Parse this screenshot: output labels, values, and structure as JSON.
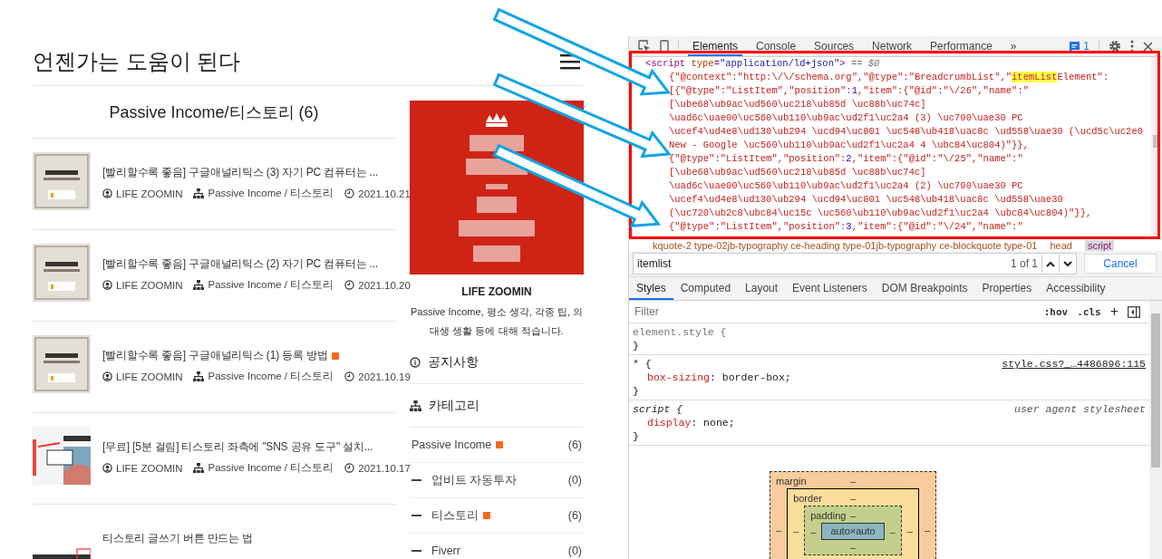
{
  "blog": {
    "title": "언젠가는 도움이 된다",
    "category_heading": "Passive Income/티스토리 (6)",
    "posts": [
      {
        "title": "[빨리할수록 좋음] 구글애널리틱스 (3) 자기 PC 컴퓨터는 ...",
        "new": false,
        "author": "LIFE ZOOMIN",
        "category": "Passive Income / 티스토리",
        "date": "2021.10.21"
      },
      {
        "title": "[빨리할수록 좋음] 구글애널리틱스 (2) 자기 PC 컴퓨터는 ...",
        "new": false,
        "author": "LIFE ZOOMIN",
        "category": "Passive Income / 티스토리",
        "date": "2021.10.20"
      },
      {
        "title": "[빨리할수록 좋음] 구글애널리틱스 (1) 등록 방법",
        "new": true,
        "author": "LIFE ZOOMIN",
        "category": "Passive Income / 티스토리",
        "date": "2021.10.19"
      },
      {
        "title": "[무료] [5분 걸림] 티스토리 좌측에 \"SNS 공유 도구\" 설치...",
        "new": false,
        "author": "LIFE ZOOMIN",
        "category": "Passive Income / 티스토리",
        "date": "2021.10.17"
      },
      {
        "title": "티스토리 글쓰기 버튼 만드는 법",
        "new": false
      }
    ],
    "profile": {
      "name": "LIFE ZOOMIN",
      "description": "Passive Income, 평소 생각, 각종 팁, 의대생 생활 등에 대해 적습니다."
    },
    "notice_heading": "공지사항",
    "category_section": {
      "heading": "카테고리",
      "items": [
        {
          "name": "Passive Income",
          "new": true,
          "count": "(6)",
          "children": [
            {
              "name": "업비트 자동투자",
              "new": false,
              "count": "(0)"
            },
            {
              "name": "티스토리",
              "new": true,
              "count": "(6)"
            },
            {
              "name": "Fiverr",
              "new": false,
              "count": "(0)"
            }
          ]
        }
      ]
    }
  },
  "devtools": {
    "tabs": [
      {
        "label": "Elements",
        "selected": true
      },
      {
        "label": "Console",
        "selected": false
      },
      {
        "label": "Sources",
        "selected": false
      },
      {
        "label": "Network",
        "selected": false
      },
      {
        "label": "Performance",
        "selected": false
      }
    ],
    "more": "»",
    "message_count": "1",
    "code_lines": [
      [
        {
          "kind": "tag",
          "text": "<script"
        },
        {
          "kind": "attr",
          "text": " type"
        },
        {
          "kind": "tag",
          "text": "="
        },
        {
          "kind": "value",
          "text": "\"application/ld+json\""
        },
        {
          "kind": "tag",
          "text": ">"
        },
        {
          "kind": "note",
          "text": " == $0"
        }
      ],
      [
        {
          "kind": "text",
          "text": "{\"@context\":\"http:\\/\\/schema.org\",\"@type\":\"BreadcrumbList\",\""
        },
        {
          "kind": "highlight",
          "text": "itemList"
        },
        {
          "kind": "text",
          "text": "Element\":"
        }
      ],
      [
        {
          "kind": "text",
          "text": "[{\"@type\":\"ListItem\",\"position\":"
        },
        {
          "kind": "number",
          "text": "1"
        },
        {
          "kind": "text",
          "text": ",\"item\":{\"@id\":\"\\/26\",\"name\":\""
        }
      ],
      [
        {
          "kind": "text",
          "text": "[\\ube68\\ub9ac\\ud560\\uc218\\ub85d \\uc88b\\uc74c]"
        }
      ],
      [
        {
          "kind": "text",
          "text": "\\uad6c\\uae00\\uc560\\ub110\\ub9ac\\ud2f1\\uc2a4 (3) \\uc790\\uae30 PC"
        }
      ],
      [
        {
          "kind": "text",
          "text": "\\ucef4\\ud4e8\\ud130\\ub294 \\ucd94\\uc801 \\uc548\\ub418\\uac8c \\ud558\\uae30 (\\ucd5c\\uc2e0"
        }
      ],
      [
        {
          "kind": "text",
          "text": "New - Google \\uc560\\ub110\\ub9ac\\ud2f1\\uc2a4 4 \\ubc84\\uc804)\"}},"
        }
      ],
      [
        {
          "kind": "text",
          "text": "{\"@type\":\"ListItem\",\"position\":"
        },
        {
          "kind": "number",
          "text": "2"
        },
        {
          "kind": "text",
          "text": ",\"item\":{\"@id\":\"\\/25\",\"name\":\""
        }
      ],
      [
        {
          "kind": "text",
          "text": "[\\ube68\\ub9ac\\ud560\\uc218\\ub85d \\uc88b\\uc74c]"
        }
      ],
      [
        {
          "kind": "text",
          "text": "\\uad6c\\uae00\\uc560\\ub110\\ub9ac\\ud2f1\\uc2a4 (2) \\uc790\\uae30 PC"
        }
      ],
      [
        {
          "kind": "text",
          "text": "\\ucef4\\ud4e8\\ud130\\ub294 \\ucd94\\uc801 \\uc548\\ub418\\uac8c \\ud558\\uae30"
        }
      ],
      [
        {
          "kind": "text",
          "text": "(\\uc720\\ub2c8\\ubc84\\uc15c \\uc560\\ub110\\ub9ac\\ud2f1\\uc2a4 \\ubc84\\uc804)\"}},"
        }
      ],
      [
        {
          "kind": "text",
          "text": "{\"@type\":\"ListItem\",\"position\":"
        },
        {
          "kind": "number",
          "text": "3"
        },
        {
          "kind": "text",
          "text": ",\"item\":{\"@id\":\"\\/24\",\"name\":\""
        }
      ]
    ],
    "breadcrumb": [
      {
        "label": "kquote-2 type-02jb-typography ce-heading type-01jb-typography ce-blockquote type-01",
        "selected": false
      },
      {
        "label": "head",
        "selected": false
      },
      {
        "label": "script",
        "selected": true
      }
    ],
    "search": {
      "value": "itemlist",
      "match_count": "1 of 1",
      "cancel": "Cancel"
    },
    "style_tabs": [
      {
        "label": "Styles",
        "selected": true
      },
      {
        "label": "Computed",
        "selected": false
      },
      {
        "label": "Layout",
        "selected": false
      },
      {
        "label": "Event Listeners",
        "selected": false
      },
      {
        "label": "DOM Breakpoints",
        "selected": false
      },
      {
        "label": "Properties",
        "selected": false
      },
      {
        "label": "Accessibility",
        "selected": false
      }
    ],
    "filter": {
      "placeholder": "Filter",
      "hov": ":hov",
      "cls": ".cls",
      "add": "+"
    },
    "rules": [
      {
        "kind": "inline",
        "selector": "element.style {",
        "close": "}"
      },
      {
        "kind": "author",
        "selector": "* {",
        "source": "style.css?_…4486896:115",
        "declarations": [
          {
            "property": "box-sizing",
            "value": ": border-box;"
          }
        ],
        "close": "}"
      },
      {
        "kind": "user-agent",
        "selector": "script {",
        "source": "user agent stylesheet",
        "declarations": [
          {
            "property": "display",
            "value": ": none;"
          }
        ],
        "close": "}"
      }
    ],
    "box_model": {
      "margin": "margin",
      "border": "border",
      "padding": "padding",
      "content": "auto×auto",
      "empty": "–"
    }
  }
}
